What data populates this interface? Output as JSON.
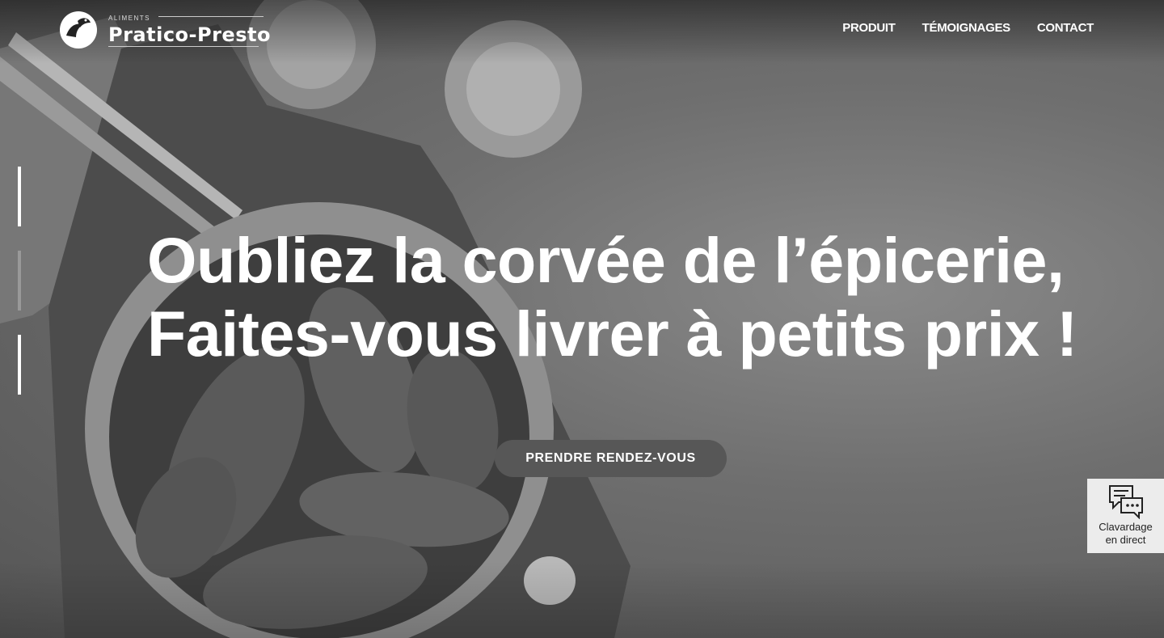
{
  "brand": {
    "small_label": "ALIMENTS",
    "name": "Pratico-Presto",
    "logo_icon": "hand-with-bird-logo-icon"
  },
  "nav": {
    "items": [
      {
        "label": "PRODUIT"
      },
      {
        "label": "TÉMOIGNAGES"
      },
      {
        "label": "CONTACT"
      }
    ]
  },
  "hero": {
    "headline_line1": "Oubliez la corvée de l’épicerie,",
    "headline_line2": "Faites-vous livrer à petits prix !",
    "cta_label": "PRENDRE RENDEZ-VOUS",
    "slide_count": 3,
    "active_slide": 1
  },
  "chat_widget": {
    "icon": "chat-bubbles-icon",
    "label_line1": "Clavardage",
    "label_line2": "en direct"
  },
  "colors": {
    "background": "#6f6f6f",
    "cta_background": "#575757",
    "chat_background": "#ececec",
    "text": "#ffffff"
  }
}
